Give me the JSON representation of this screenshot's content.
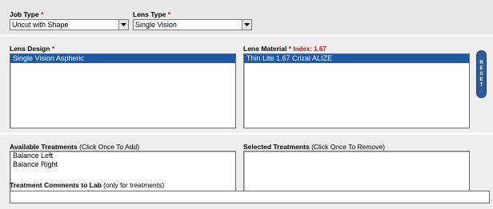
{
  "job_type": {
    "label": "Job Type",
    "required_mark": "*",
    "selected": "Uncut with Shape"
  },
  "lens_type": {
    "label": "Lens Type",
    "required_mark": "*",
    "selected": "Single Vision"
  },
  "lens_design": {
    "label": "Lens Design",
    "required_mark": "*",
    "options": [
      {
        "text": "Single Vision Aspheric",
        "selected": true
      }
    ]
  },
  "lens_material": {
    "label": "Lens Material",
    "required_mark": "*",
    "index_text": "Index: 1.67",
    "options": [
      {
        "text": "Thin Lite 1.67 Crizal ALIZE",
        "selected": true
      }
    ]
  },
  "reset_button": {
    "label": "RESET"
  },
  "available_treatments": {
    "label": "Available Treatments",
    "hint": "(Click Once To Add)",
    "items": [
      "Balance Left",
      "Balance Right"
    ]
  },
  "selected_treatments": {
    "label": "Selected Treatments",
    "hint": "(Click Once To Remove)",
    "items": []
  },
  "treatment_comments": {
    "label": "Treatment Comments to Lab",
    "hint": "(only for treatments)",
    "value": ""
  },
  "colors": {
    "selection": "#1e56a8",
    "required": "#d01010",
    "reset": "#2c5a9a"
  }
}
